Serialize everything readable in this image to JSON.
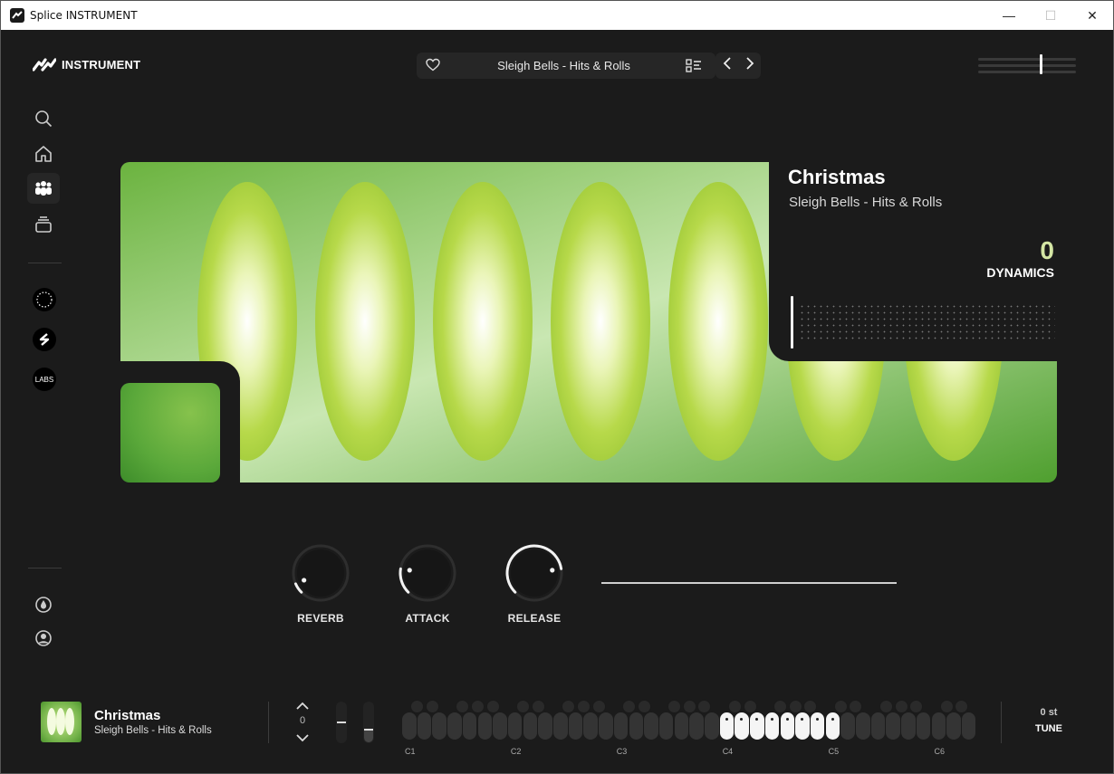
{
  "window": {
    "title": "Splice INSTRUMENT",
    "minimize": "—",
    "maximize": "☐",
    "close": "✕"
  },
  "header": {
    "logo_text": "INSTRUMENT",
    "preset_name": "Sleigh Bells - Hits & Rolls",
    "master_volume": 0.63
  },
  "sidebar": {
    "items": [
      {
        "name": "search",
        "icon": "search-icon"
      },
      {
        "name": "home",
        "icon": "home-icon"
      },
      {
        "name": "community",
        "icon": "people-icon",
        "active": true
      },
      {
        "name": "library",
        "icon": "stack-icon"
      }
    ],
    "packs": [
      {
        "icon": "pack-dots-icon"
      },
      {
        "icon": "splice-logo-icon"
      },
      {
        "label": "LABS",
        "icon": "labs-icon"
      }
    ],
    "bottom": [
      {
        "icon": "droplet-icon"
      },
      {
        "icon": "user-icon"
      }
    ]
  },
  "instrument": {
    "title": "Christmas",
    "subtitle": "Sleigh Bells - Hits & Rolls",
    "dynamics_value": "0",
    "dynamics_label": "DYNAMICS"
  },
  "knobs": [
    {
      "label": "REVERB",
      "value": 0.08
    },
    {
      "label": "ATTACK",
      "value": 0.2
    },
    {
      "label": "RELEASE",
      "value": 0.8
    }
  ],
  "footer": {
    "title": "Christmas",
    "subtitle": "Sleigh Bells - Hits & Rolls",
    "octave": "0",
    "octave_labels": [
      "C1",
      "C2",
      "C3",
      "C4",
      "C5",
      "C6"
    ],
    "tune_value": "0 st",
    "tune_label": "TUNE"
  },
  "colors": {
    "accent_green": "#8cc63f",
    "dynamics_value": "#d4e6a4",
    "background": "#1b1b1b"
  }
}
